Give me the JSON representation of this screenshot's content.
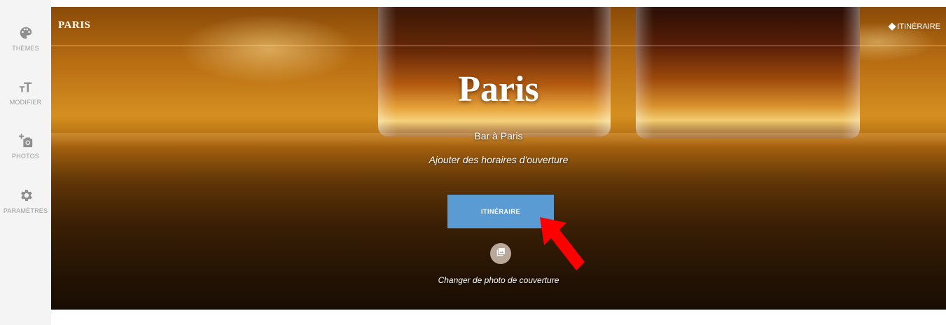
{
  "sidebar": {
    "items": [
      {
        "label": "THÈMES",
        "icon": "palette-icon"
      },
      {
        "label": "MODIFIER",
        "icon": "text-size-icon"
      },
      {
        "label": "PHOTOS",
        "icon": "add-photo-icon"
      },
      {
        "label": "PARAMÈTRES",
        "icon": "gear-icon"
      }
    ]
  },
  "header": {
    "brand": "PARIS",
    "link_label": "ITINÉRAIRE",
    "link_icon": "diamond-direction-icon"
  },
  "hero": {
    "title": "Paris",
    "subtitle": "Bar à Paris",
    "hours_link": "Ajouter des horaires d'ouverture",
    "cta_label": "ITINÉRAIRE",
    "cta_color": "#5b9bd3",
    "photo_icon": "photo-change-icon",
    "photo_caption": "Changer de photo de couverture"
  },
  "annotation": {
    "icon": "red-arrow-icon",
    "color": "#ff0000"
  }
}
